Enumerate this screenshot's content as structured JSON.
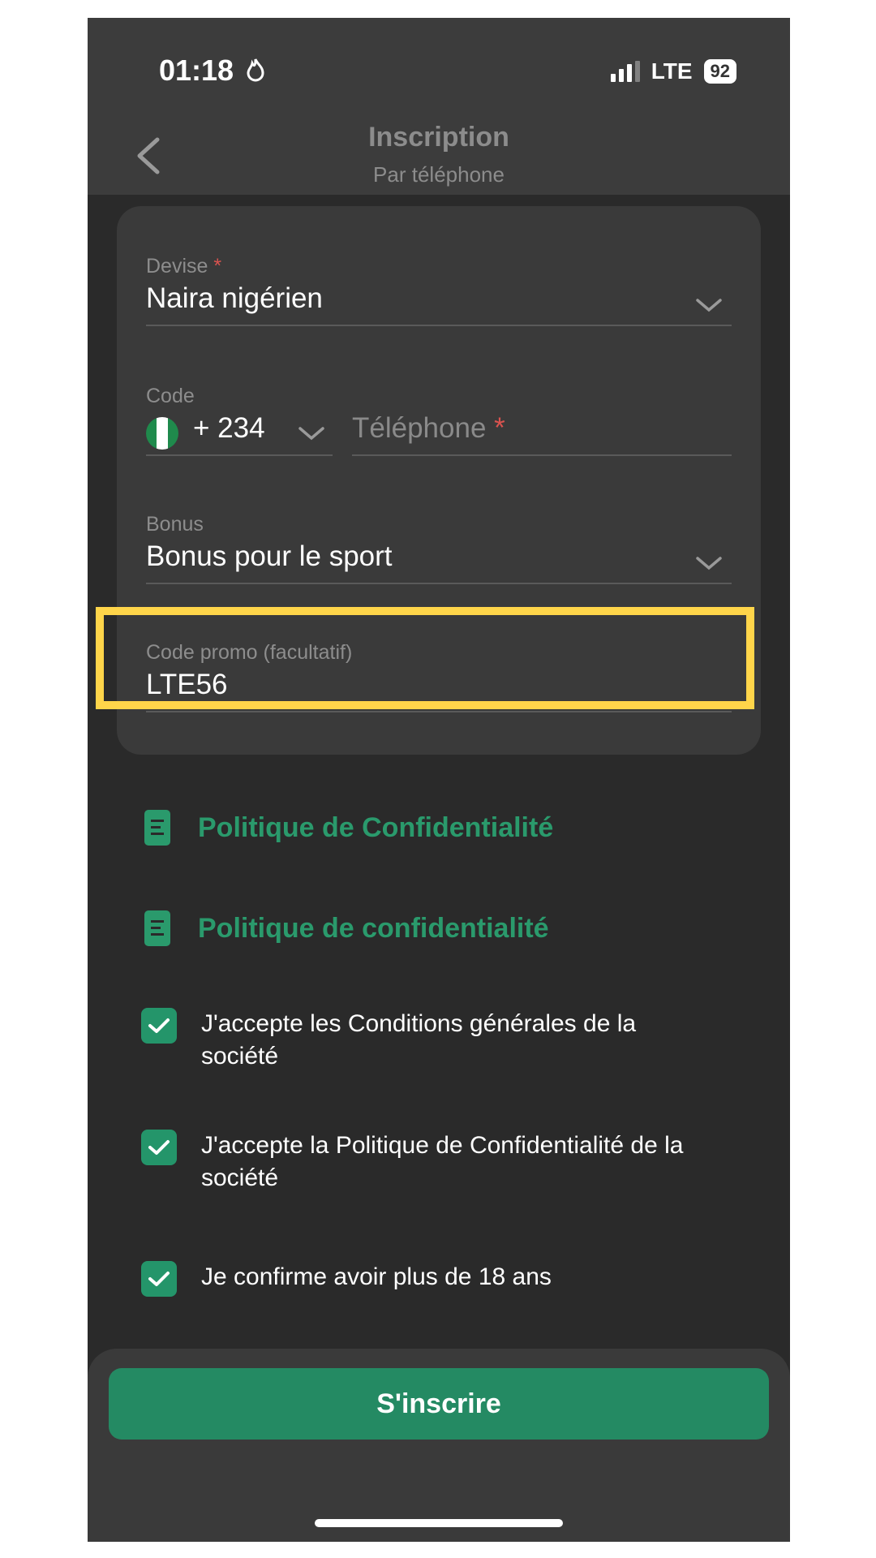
{
  "status_bar": {
    "time": "01:18",
    "network": "LTE",
    "battery": "92"
  },
  "header": {
    "title": "Inscription",
    "subtitle": "Par téléphone"
  },
  "form": {
    "currency": {
      "label": "Devise",
      "required_mark": "*",
      "value": "Naira nigérien"
    },
    "phone": {
      "code_label": "Code",
      "code_value": "+ 234",
      "placeholder": "Téléphone",
      "required_mark": "*"
    },
    "bonus": {
      "label": "Bonus",
      "value": "Bonus pour le sport"
    },
    "promo": {
      "label": "Code promo (facultatif)",
      "value": "LTE56"
    }
  },
  "links": [
    {
      "label": "Politique de Confidentialité"
    },
    {
      "label": "Politique de confidentialité"
    }
  ],
  "agreements": [
    {
      "label": "J'accepte les Conditions générales de la société",
      "checked": true
    },
    {
      "label": "J'accepte la Politique de Confidentialité de la société",
      "checked": true
    },
    {
      "label": "Je confirme avoir plus de 18 ans",
      "checked": true
    }
  ],
  "submit": {
    "label": "S'inscrire"
  },
  "colors": {
    "accent": "#248a63",
    "highlight": "#ffd54a",
    "link": "#2a9a6c"
  }
}
